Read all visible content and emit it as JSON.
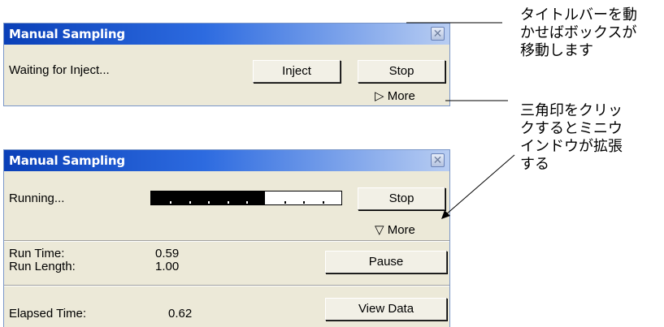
{
  "dialog_collapsed": {
    "title": "Manual Sampling",
    "status": "Waiting for Inject...",
    "inject_label": "Inject",
    "stop_label": "Stop",
    "more_label": "▷ More"
  },
  "dialog_expanded": {
    "title": "Manual Sampling",
    "status": "Running...",
    "progress": 0.6,
    "stop_label": "Stop",
    "more_label": "▽ More",
    "run_time_label": "Run Time:",
    "run_time_value": "0.59",
    "run_length_label": "Run Length:",
    "run_length_value": "1.00",
    "pause_label": "Pause",
    "elapsed_label": "Elapsed Time:",
    "elapsed_value": "0.62",
    "view_data_label": "View Data"
  },
  "annotations": {
    "title_bar": [
      "タイトルバーを動",
      "かせばボックスが",
      "移動します"
    ],
    "triangle": [
      "三角印をクリッ",
      "クするとミニウ",
      "インドウが拡張",
      "する"
    ]
  },
  "colors": {
    "titlebar_start": "#0a40b8",
    "titlebar_end": "#b8cdf2",
    "window_face": "#ece9d8"
  }
}
